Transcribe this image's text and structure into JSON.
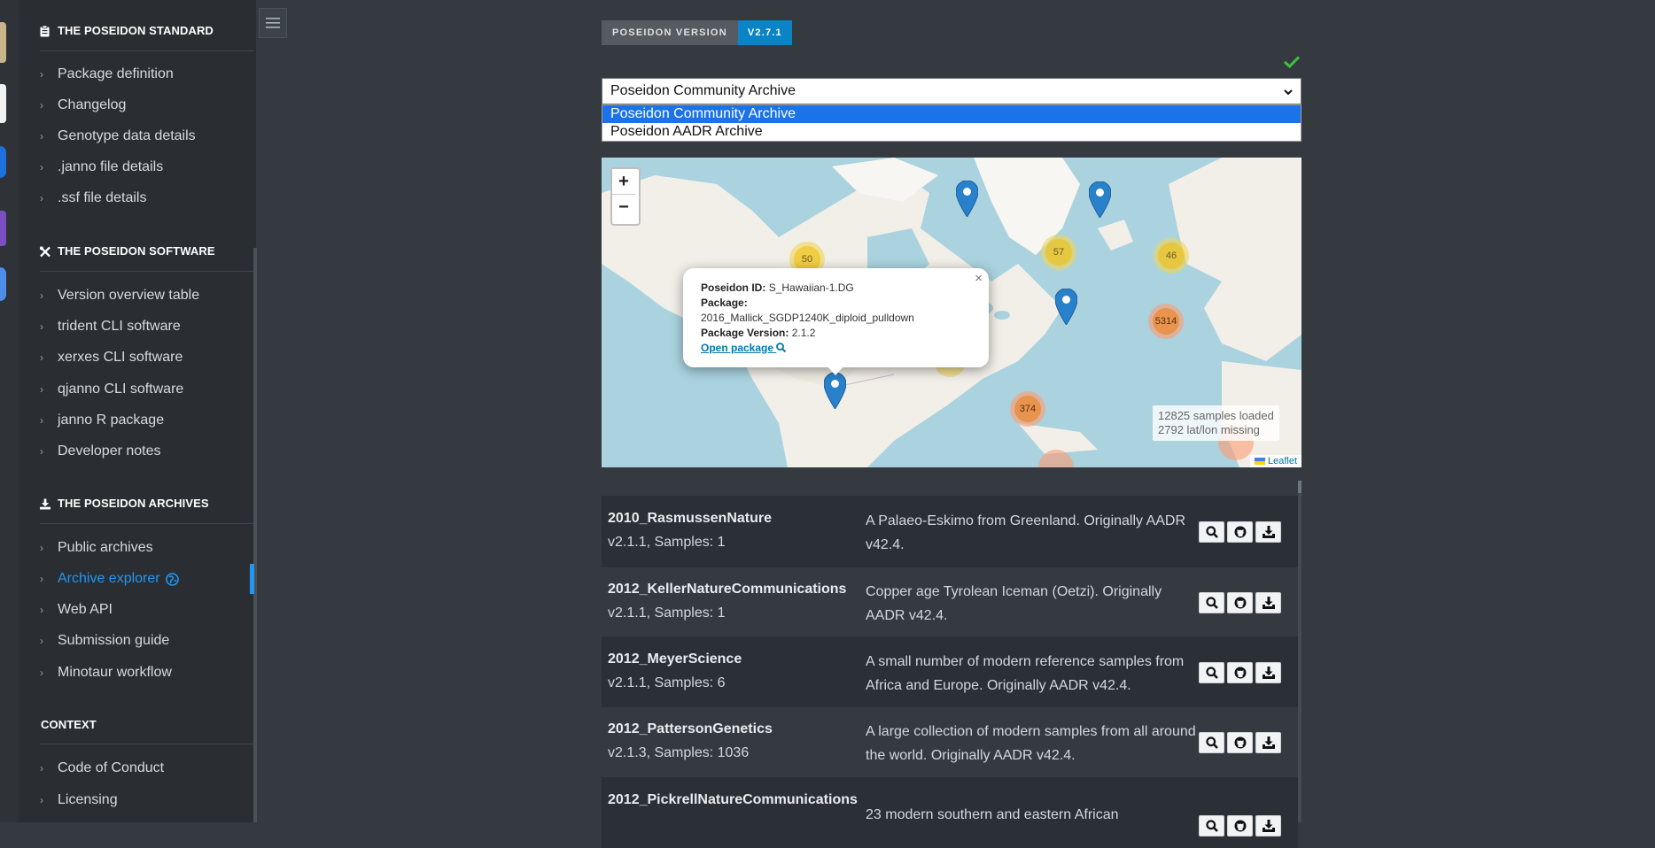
{
  "sidebar": {
    "sections": [
      {
        "title": "THE POSEIDON STANDARD",
        "icon": "clipboard-icon",
        "items": [
          "Package definition",
          "Changelog",
          "Genotype data details",
          ".janno file details",
          ".ssf file details"
        ]
      },
      {
        "title": "THE POSEIDON SOFTWARE",
        "icon": "tools-icon",
        "items": [
          "Version overview table",
          "trident CLI software",
          "xerxes CLI software",
          "qjanno CLI software",
          "janno R package",
          "Developer notes"
        ]
      },
      {
        "title": "THE POSEIDON ARCHIVES",
        "icon": "download-icon",
        "items": [
          "Public archives",
          "Archive explorer",
          "Web API",
          "Submission guide",
          "Minotaur workflow"
        ]
      },
      {
        "title": "CONTEXT",
        "icon": "",
        "items": [
          "Code of Conduct",
          "Licensing"
        ]
      }
    ],
    "active_item": "Archive explorer"
  },
  "header": {
    "version_label": "POSEIDON VERSION",
    "version_value": "V2.7.1"
  },
  "archive_select": {
    "selected": "Poseidon Community Archive",
    "options": [
      "Poseidon Community Archive",
      "Poseidon AADR Archive"
    ]
  },
  "map": {
    "zoom_in": "+",
    "zoom_out": "−",
    "clusters": [
      "50",
      "57",
      "46",
      "5314",
      "374"
    ],
    "popup": {
      "id_label": "Poseidon ID:",
      "id_value": "S_Hawaiian-1.DG",
      "package_label": "Package:",
      "package_value": "2016_Mallick_SGDP1240K_diploid_pulldown",
      "version_label": "Package Version:",
      "version_value": "2.1.2",
      "link": "Open package",
      "close": "×"
    },
    "counts": {
      "loaded": "12825 samples loaded",
      "missing": "2792 lat/lon missing"
    },
    "attribution": "Leaflet"
  },
  "packages": [
    {
      "name": "2010_RasmussenNature",
      "meta": "v2.1.1, Samples: 1",
      "desc": "A Palaeo-Eskimo from Greenland. Originally AADR v42.4."
    },
    {
      "name": "2012_KellerNatureCommunications",
      "meta": "v2.1.1, Samples: 1",
      "desc": "Copper age Tyrolean Iceman (Oetzi). Originally AADR v42.4."
    },
    {
      "name": "2012_MeyerScience",
      "meta": "v2.1.1, Samples: 6",
      "desc": "A small number of modern reference samples from Africa and Europe. Originally AADR v42.4."
    },
    {
      "name": "2012_PattersonGenetics",
      "meta": "v2.1.3, Samples: 1036",
      "desc": "A large collection of modern samples from all around the world. Originally AADR v42.4."
    },
    {
      "name": "2012_PickrellNatureCommunications",
      "meta": "",
      "desc": "23 modern southern and eastern African"
    }
  ],
  "colors": {
    "accent": "#2196f3",
    "badge": "#0a84c6",
    "check": "#3fc13f"
  }
}
